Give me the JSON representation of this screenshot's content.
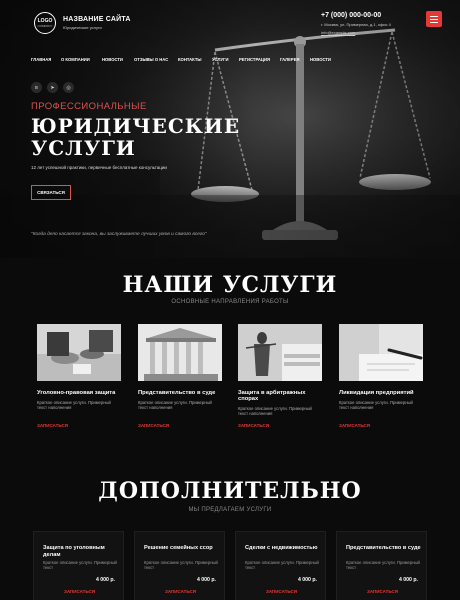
{
  "header": {
    "logo_text": "LOGO",
    "logo_subtext": "COMPANY",
    "site_title": "НАЗВАНИЕ САЙТА",
    "site_subtitle": "Юридические услуги",
    "phone": "+7 (000) 000-00-00",
    "address": "г. Москва, ул. Примерная, д.1, офис 4",
    "email": "info@example.com",
    "menu_icon": "hamburger-icon",
    "accent_color": "#e53935"
  },
  "nav": {
    "items": [
      "ГЛАВНАЯ",
      "О КОМПАНИИ",
      "НОВОСТИ",
      "ОТЗЫВЫ О НАС",
      "КОНТАКТЫ",
      "УСЛУГИ",
      "РЕГИСТРАЦИЯ",
      "ГАЛЕРЕЯ",
      "НОВОСТИ"
    ]
  },
  "socials": [
    "vk-icon",
    "telegram-icon",
    "instagram-icon"
  ],
  "hero": {
    "kicker": "ПРОФЕССИОНАЛЬНЫЕ",
    "title_line1": "ЮРИДИЧЕСКИЕ",
    "title_line2": "УСЛУГИ",
    "description": "12 лет успешной практики, первичные бесплатные консультации",
    "cta": "СВЯЗАТЬСЯ",
    "quote": "\"Когда дело касается закона, вы заслуживаете лучших умов и самого всего\""
  },
  "services": {
    "title": "НАШИ УСЛУГИ",
    "subtitle": "ОСНОВНЫЕ НАПРАВЛЕНИЯ РАБОТЫ",
    "items": [
      {
        "name": "Уголовно-правовая защита",
        "desc": "Краткое описание услуги. Примерный текст наполнения",
        "link": "ЗАПИСАТЬСЯ"
      },
      {
        "name": "Представительство в суде",
        "desc": "Краткое описание услуги. Примерный текст наполнения",
        "link": "ЗАПИСАТЬСЯ"
      },
      {
        "name": "Защита в арбитражных спорах",
        "desc": "Краткое описание услуги. Примерный текст наполнения",
        "link": "ЗАПИСАТЬСЯ"
      },
      {
        "name": "Ликвидация предприятий",
        "desc": "Краткое описание услуги. Примерный текст наполнения",
        "link": "ЗАПИСАТЬСЯ"
      }
    ]
  },
  "extra": {
    "title": "ДОПОЛНИТЕЛЬНО",
    "subtitle": "МЫ ПРЕДЛАГАЕМ УСЛУГИ",
    "items": [
      {
        "name": "Защита по уголовным делам",
        "desc": "Краткое описание услуги. Примерный текст",
        "price": "4 000 р.",
        "link": "ЗАПИСАТЬСЯ"
      },
      {
        "name": "Решение семейных ссор",
        "desc": "Краткое описание услуги. Примерный текст",
        "price": "4 000 р.",
        "link": "ЗАПИСАТЬСЯ"
      },
      {
        "name": "Сделки с недвижимостью",
        "desc": "Краткое описание услуги. Примерный текст",
        "price": "4 000 р.",
        "link": "ЗАПИСАТЬСЯ"
      },
      {
        "name": "Представительство в суде",
        "desc": "Краткое описание услуги. Примерный текст",
        "price": "4 000 р.",
        "link": "ЗАПИСАТЬСЯ"
      }
    ]
  }
}
